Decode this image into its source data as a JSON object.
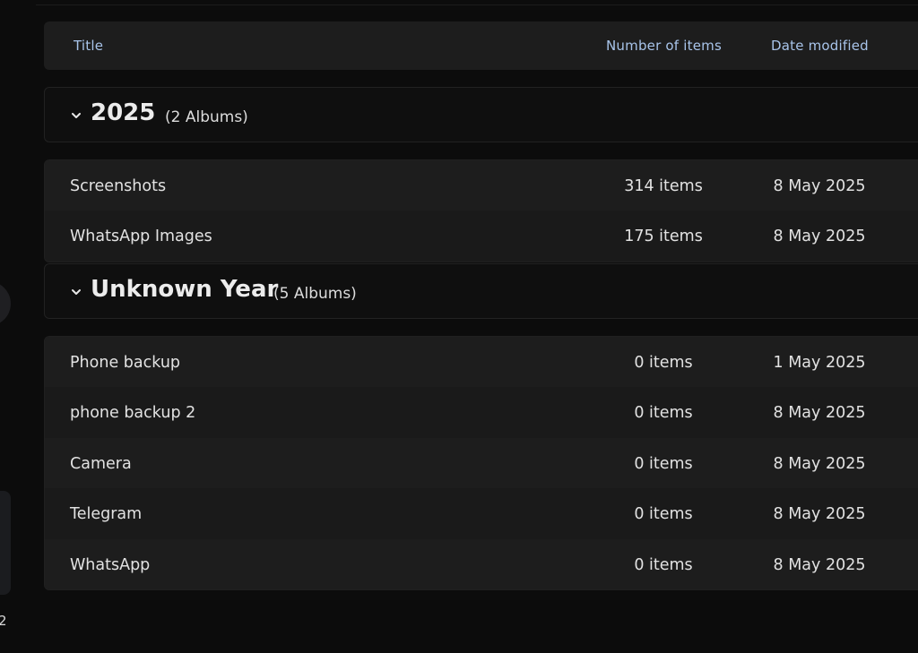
{
  "rail": {
    "partial_label": "2"
  },
  "table": {
    "headers": {
      "title": "Title",
      "count": "Number of items",
      "date": "Date modified"
    }
  },
  "groups": [
    {
      "title": "2025",
      "count_label": "(2 Albums)",
      "rows": [
        {
          "title": "Screenshots",
          "count": "314 items",
          "date": "8 May 2025"
        },
        {
          "title": "WhatsApp Images",
          "count": "175 items",
          "date": "8 May 2025"
        }
      ]
    },
    {
      "title": "Unknown Year",
      "count_label": "(5 Albums)",
      "rows": [
        {
          "title": "Phone backup",
          "count": "0 items",
          "date": "1 May 2025"
        },
        {
          "title": "phone backup 2",
          "count": "0 items",
          "date": "8 May 2025"
        },
        {
          "title": "Camera",
          "count": "0 items",
          "date": "8 May 2025"
        },
        {
          "title": "Telegram",
          "count": "0 items",
          "date": "8 May 2025"
        },
        {
          "title": "WhatsApp",
          "count": "0 items",
          "date": "8 May 2025"
        }
      ]
    }
  ],
  "icons": {
    "group_toggle": "chevron-down-icon"
  }
}
